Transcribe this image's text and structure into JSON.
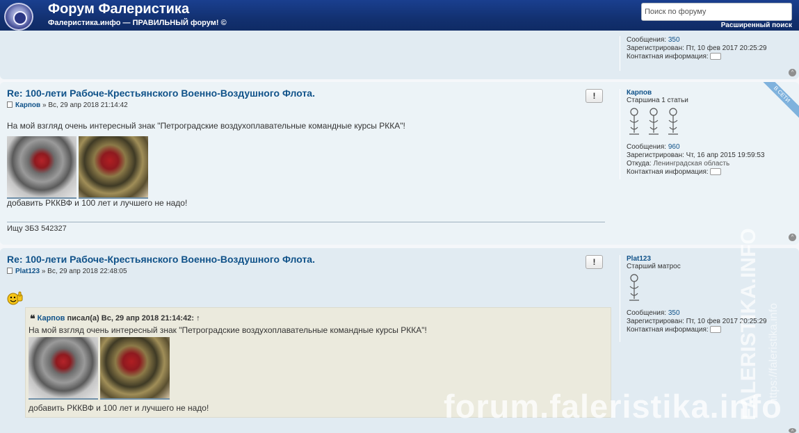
{
  "header": {
    "title": "Форум Фалеристика",
    "description": "Фалеристика.инфо — ПРАВИЛЬНЫЙ форум! ©",
    "search_placeholder": "Поиск по форуму",
    "advanced_search": "Расширенный поиск"
  },
  "labels": {
    "messages": "Сообщения:",
    "registered": "Зарегистрирован:",
    "location": "Откуда:",
    "contact": "Контактная информация:",
    "report": "!",
    "top": "^",
    "online": "В СЕТИ",
    "quote_wrote": "писал(а)",
    "quote_arrow": "↑"
  },
  "prev_post": {
    "profile": {
      "messages": "350",
      "registered": "Пт, 10 фев 2017 20:25:29"
    }
  },
  "post1": {
    "title": "Re: 100-лети Рабоче-Крестьянского Военно-Воздушного Флота.",
    "author": "Карпов",
    "date": "» Вс, 29 апр 2018 21:14:42",
    "text1": "На мой взгляд очень интересный знак \"Петроградские воздухоплавательные командные курсы РККА\"!",
    "text2": "добавить РККВФ и 100 лет и лучшего не надо!",
    "signature": "Ищу ЗБЗ 542327",
    "profile": {
      "username": "Карпов",
      "rank": "Старшина 1 статьи",
      "messages": "960",
      "registered": "Чт, 16 апр 2015 19:59:53",
      "location": "Ленинградская область"
    }
  },
  "post2": {
    "title": "Re: 100-лети Рабоче-Крестьянского Военно-Воздушного Флота.",
    "author": "Plat123",
    "date": "» Вс, 29 апр 2018 22:48:05",
    "quote": {
      "author": "Карпов",
      "date": "Вс, 29 апр 2018 21:14:42:",
      "text1": "На мой взгляд очень интересный знак \"Петроградские воздухоплавательные командные курсы РККА\"!",
      "text2": "добавить РККВФ и 100 лет и лучшего не надо!"
    },
    "profile": {
      "username": "Plat123",
      "rank": "Старший матрос",
      "messages": "350",
      "registered": "Пт, 10 фев 2017 20:25:29"
    }
  },
  "watermark": {
    "main": "forum.faleristika.info",
    "vertical1": "FALERISTIKA.INFO",
    "vertical2": "https://faleristika.info"
  },
  "colors": {
    "header": "#12306f",
    "link": "#105289",
    "panel_bg1": "#e1ebf2",
    "panel_bg2": "#ecf3f7",
    "quote_bg": "#ebeadd"
  }
}
